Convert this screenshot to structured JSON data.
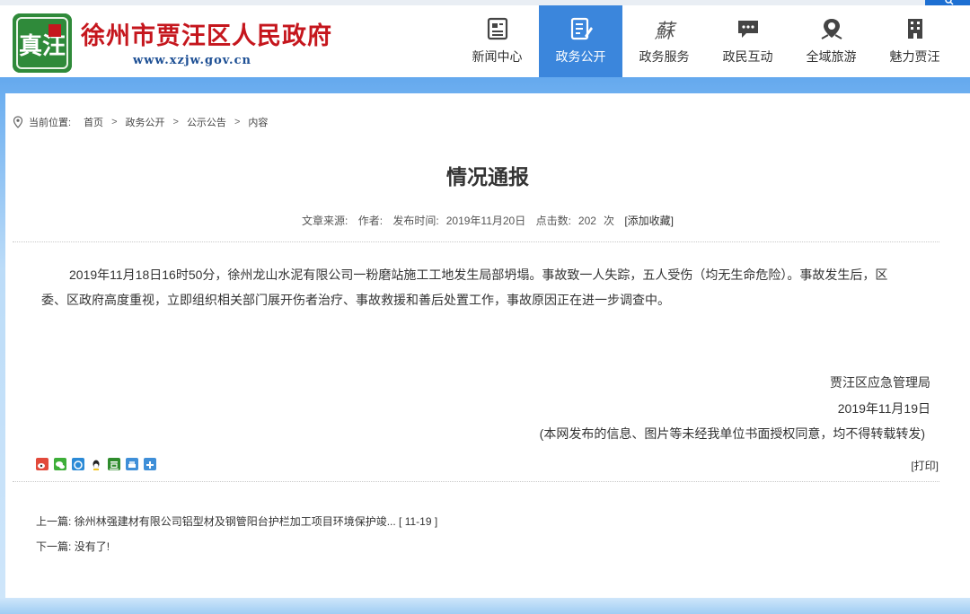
{
  "header": {
    "site_title": "徐州市贾汪区人民政府",
    "site_url": "www.xzjw.gov.cn",
    "logo_glyphs": "真汪",
    "brand_color": "#c5161d",
    "nav_active_color": "#3b86dc",
    "nav": [
      {
        "label": "新闻中心",
        "icon": "newspaper-icon",
        "active": false
      },
      {
        "label": "政务公开",
        "icon": "document-edit-icon",
        "active": true
      },
      {
        "label": "政务服务",
        "icon": "calligraphy-su-icon",
        "calligraphy": "蘇",
        "active": false
      },
      {
        "label": "政民互动",
        "icon": "chat-bubble-icon",
        "active": false
      },
      {
        "label": "全域旅游",
        "icon": "map-pin-icon",
        "active": false
      },
      {
        "label": "魅力贾汪",
        "icon": "building-icon",
        "active": false
      }
    ]
  },
  "breadcrumb": {
    "prefix": "当前位置:",
    "items": [
      "首页",
      "政务公开",
      "公示公告",
      "内容"
    ],
    "separator": ">"
  },
  "article": {
    "title": "情况通报",
    "meta": {
      "source_label": "文章来源:",
      "author_label": "作者:",
      "published_label": "发布时间:",
      "published_date": "2019年11月20日",
      "clicks_label": "点击数:",
      "clicks_value": "202",
      "clicks_unit": "次",
      "favorite": "[添加收藏]"
    },
    "body": "2019年11月18日16时50分，徐州龙山水泥有限公司一粉磨站施工工地发生局部坍塌。事故致一人失踪，五人受伤（均无生命危险）。事故发生后，区委、区政府高度重视，立即组织相关部门展开伤者治疗、事故救援和善后处置工作，事故原因正在进一步调查中。",
    "signature_org": "贾汪区应急管理局",
    "signature_date": "2019年11月19日",
    "copyright_notice": "(本网发布的信息、图片等未经我单位书面授权同意，均不得转载转发)"
  },
  "share_icons": [
    "weibo-icon",
    "wechat-icon",
    "qzone-icon",
    "qq-icon",
    "douban-icon",
    "print-share-icon",
    "more-share-icon"
  ],
  "print_label": "[打印]",
  "prev": {
    "label": "上一篇:",
    "title": "徐州林强建材有限公司铝型材及钢管阳台护栏加工项目环境保护竣...",
    "date": "[ 11-19 ]"
  },
  "next": {
    "label": "下一篇:",
    "title": "没有了!"
  }
}
